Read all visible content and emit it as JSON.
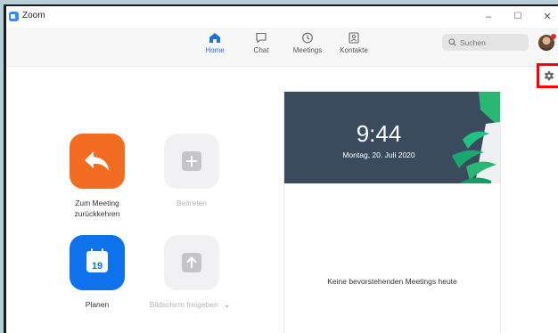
{
  "window": {
    "title": "Zoom"
  },
  "window_controls": {
    "minimize": "–",
    "maximize": "☐",
    "close": "✕"
  },
  "nav": {
    "tabs": [
      {
        "label": "Home",
        "icon": "home-icon",
        "active": true
      },
      {
        "label": "Chat",
        "icon": "chat-icon",
        "active": false
      },
      {
        "label": "Meetings",
        "icon": "clock-icon",
        "active": false
      },
      {
        "label": "Kontakte",
        "icon": "contacts-icon",
        "active": false
      }
    ]
  },
  "search": {
    "placeholder": "Suchen"
  },
  "actions": {
    "rejoin": {
      "label_line1": "Zum Meeting",
      "label_line2": "zurückkehren",
      "color": "#f26d21"
    },
    "join": {
      "label": "Beitreten"
    },
    "schedule": {
      "label": "Planen",
      "calendar_day": "19",
      "color": "#0e72ed"
    },
    "share": {
      "label": "Bildschirm freigeben",
      "dropdown": "⌄"
    }
  },
  "upcoming": {
    "time": "9:44",
    "date": "Montag, 20. Juli 2020",
    "empty_text": "Keine bevorstehenden Meetings heute"
  },
  "colors": {
    "accent": "#1e6fe0",
    "header_bg": "#3a4b5d",
    "highlight": "#ff0000"
  }
}
